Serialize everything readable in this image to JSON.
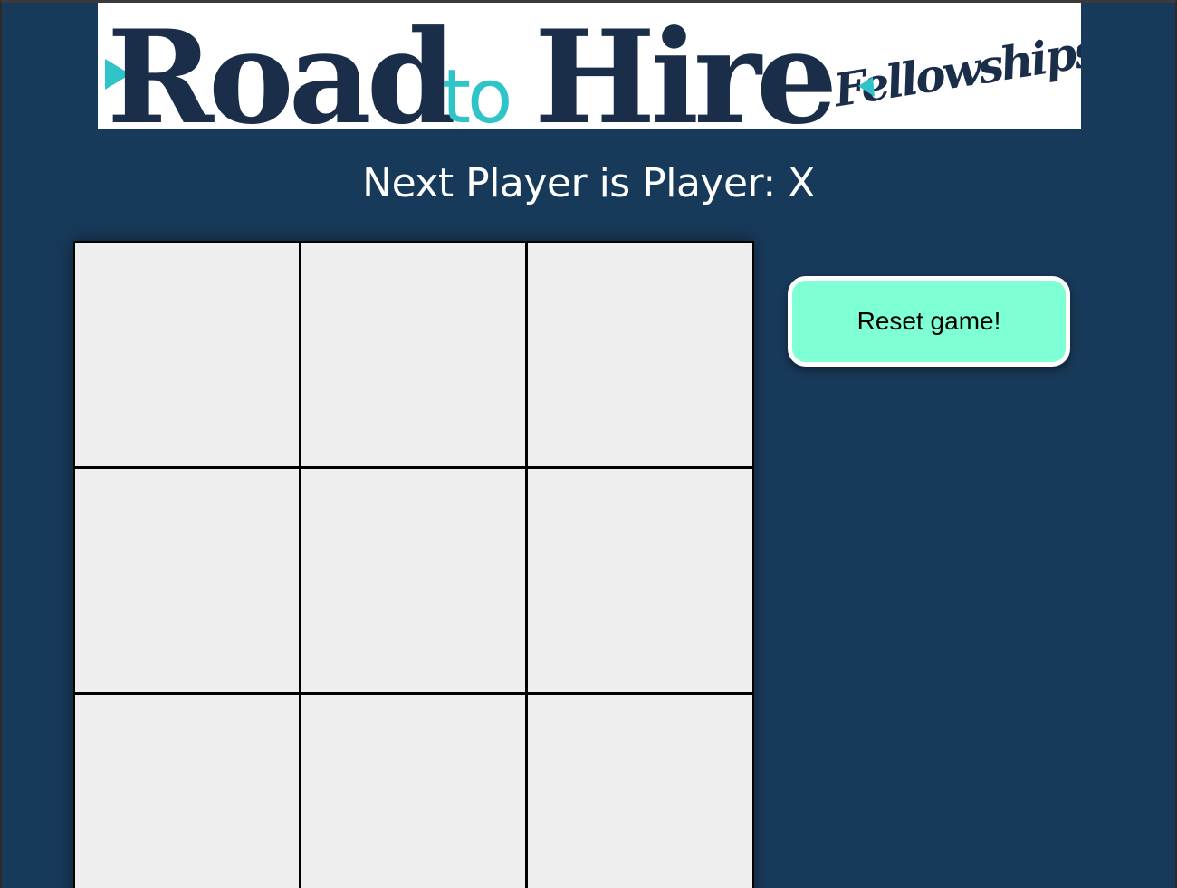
{
  "logo": {
    "word_road": "Road",
    "word_to": "to",
    "word_hire": "Hire",
    "word_fellowships": "Fellowships",
    "colors": {
      "navy": "#1a2e4a",
      "teal": "#2ec4c8",
      "background": "#ffffff"
    }
  },
  "status": {
    "text": "Next Player is Player: X"
  },
  "board": {
    "cells": [
      "",
      "",
      "",
      "",
      "",
      "",
      "",
      "",
      ""
    ]
  },
  "controls": {
    "reset_label": "Reset game!"
  },
  "colors": {
    "page_background": "#183a5a",
    "cell_background": "#eeeeee",
    "cell_border": "#000000",
    "button_background": "#7fffd4",
    "button_border": "#ffffff"
  }
}
